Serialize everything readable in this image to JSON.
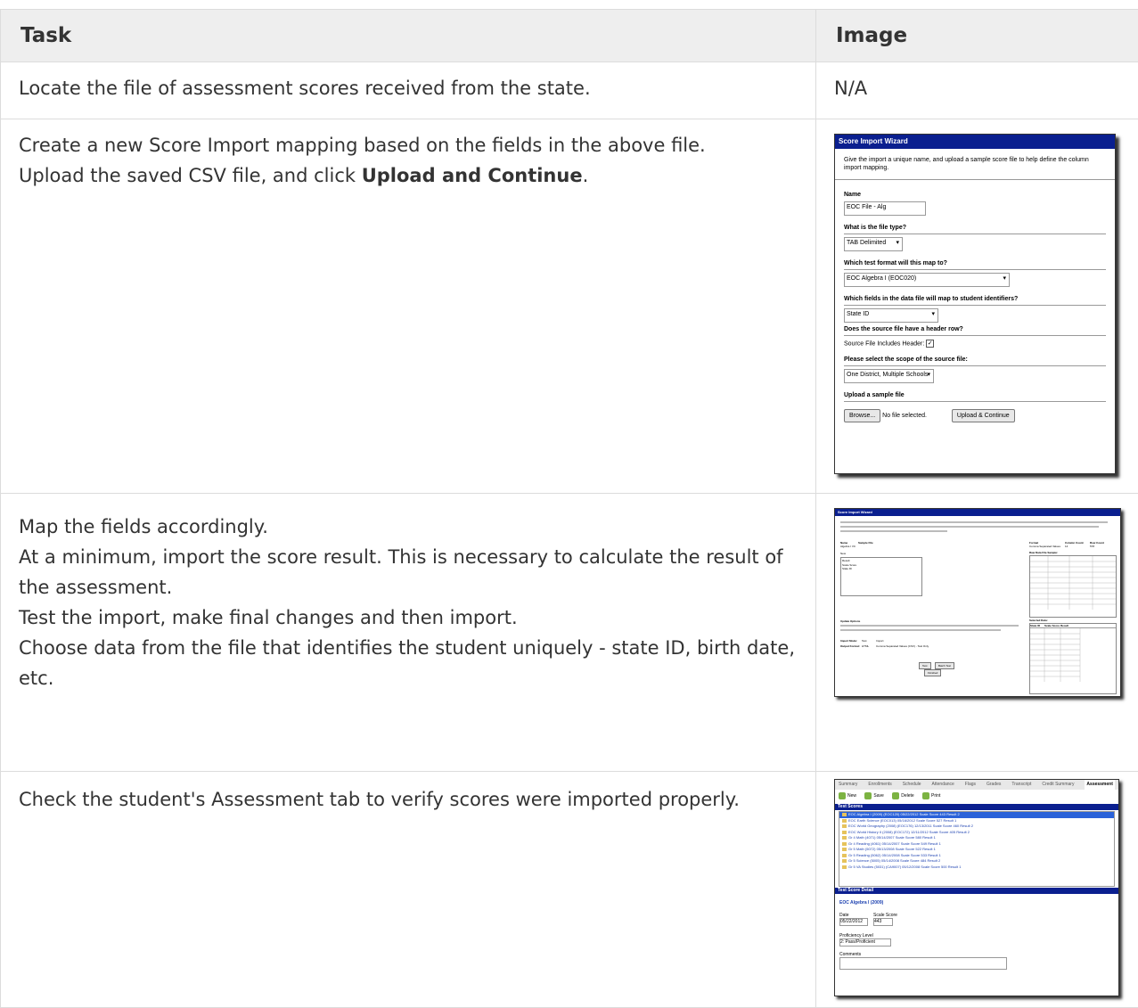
{
  "table": {
    "headers": [
      "Task",
      "Image"
    ],
    "rows": [
      {
        "task_lines": [
          "Locate the file of assessment scores received from the state."
        ],
        "image_text": "N/A"
      },
      {
        "task_lines": [
          "Create a new Score Import mapping based on the fields in the above file."
        ],
        "upload_prefix": "Upload the saved CSV file, and click ",
        "upload_bold": "Upload and Continue",
        "upload_suffix": "."
      },
      {
        "task_lines": [
          "Map the fields accordingly.",
          "At a minimum, import the score result. This is necessary to calculate the result of the assessment.",
          "Test the import, make final changes and then import.",
          "Choose data from the file that identifies the student uniquely - state ID, birth date, etc."
        ]
      },
      {
        "task_lines": [
          "Check the student's Assessment tab to verify scores were imported properly."
        ]
      }
    ]
  },
  "wizard1": {
    "title": "Score Import Wizard",
    "description": "Give the import a unique name, and upload a sample score file to help define the column import mapping.",
    "name_label": "Name",
    "name_value": "EOC File - Alg",
    "filetype_label": "What is the file type?",
    "filetype_value": "TAB Delimited",
    "format_label": "Which test format will this map to?",
    "format_value": "EOC Algebra I (EOC020)",
    "identifier_label": "Which fields in the data file will map to student identifiers?",
    "identifier_value": "State ID",
    "header_label": "Does the source file have a header row?",
    "header_checkbox_label": "Source File Includes Header:",
    "scope_label": "Please select the scope of the source file:",
    "scope_value": "One District, Multiple Schools",
    "upload_label": "Upload a sample file",
    "browse_button": "Browse...",
    "no_file_text": "No file selected.",
    "upload_continue_button": "Upload & Continue"
  },
  "wizard2": {
    "title": "Score Import Wizard",
    "name_label": "Name",
    "name_value": "Algebra I VC",
    "sample_file_label": "Sample File",
    "format_label": "Format",
    "format_value": "Comma Separated Values",
    "column_count_label": "Column Count",
    "column_count_value": "14",
    "row_count_label": "Row Count",
    "row_count_value": "578",
    "new_label": "New",
    "mapped_items": [
      "Result",
      "Scale Score",
      "State ID"
    ],
    "raw_data_label": "Raw Data File Sample:",
    "selected_data_label": "Selected Data:",
    "selected_headers": [
      "State ID",
      "Scale Score",
      "Result"
    ],
    "update_options_label": "Update Options",
    "import_mode_label": "Import Mode:",
    "import_mode_test": "Test",
    "import_mode_import": "Import",
    "output_format_label": "Output Format:",
    "output_html": "HTML",
    "output_csv": "Comma Separated Values (CSV) - Test Only",
    "test_button": "Test",
    "batch_test_button": "Batch Test",
    "finished_button": "Finished"
  },
  "screen3": {
    "tabs": [
      "Summary",
      "Enrollments",
      "Schedule",
      "Attendance",
      "Flags",
      "Grades",
      "Transcript",
      "Credit Summary",
      "Assessment"
    ],
    "active_tab": "Assessment",
    "toolbar": [
      "New",
      "Save",
      "Delete",
      "Print"
    ],
    "test_scores_header": "Test Scores",
    "scores": [
      "EOC Algebra I (2009) (EOC120) 05/22/2012 Scale Score 443 Result 2",
      "EOC Earth Science (EOC013) 05/16/2012 Scale Score 527 Result 1",
      "EOC World Geography (2008) (EOC176) 12/13/2011 Scale Score 460 Result 2",
      "EOC World History II (2008) (EOC172) 12/11/2012 Scale Score 405 Result 2",
      "Gr 4 Math (4071) 05/14/2007 Scale Score 580 Result 1",
      "Gr 4 Reading (4061) 05/14/2007 Scale Score 549 Result 1",
      "Gr 5 Math (5072) 05/13/2008 Scale Score 522 Result 1",
      "Gr 5 Reading (5062) 05/14/2008 Scale Score 533 Result 1",
      "Gr 5 Science (5005) 05/14/2008 Scale Score 484 Result 2",
      "Gr 5 VA Studies (5031) (CA9007) 05/12/2008 Scale Score 500 Result 1"
    ],
    "detail_header": "Test Score Detail",
    "detail_title": "EOC Algebra I (2009)",
    "date_label": "Date",
    "date_value": "05/22/2012",
    "scale_score_label": "Scale Score",
    "scale_score_value": "443",
    "proficiency_label": "Proficiency Level",
    "proficiency_value": "2: Pass/Proficient",
    "comments_label": "Comments"
  }
}
